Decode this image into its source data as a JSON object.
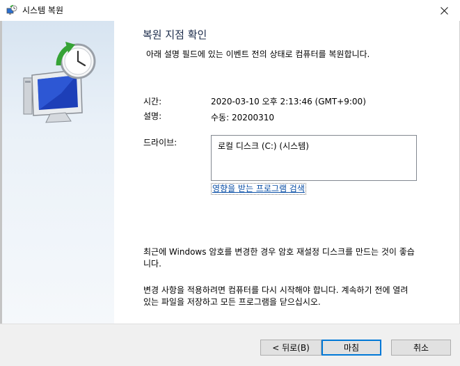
{
  "window": {
    "title": "시스템 복원"
  },
  "main": {
    "heading": "복원 지점 확인",
    "subheading": "아래 설명 필드에 있는 이벤트 전의 상태로 컴퓨터를 복원합니다.",
    "time_label": "시간:",
    "time_value": "2020-03-10 오후 2:13:46 (GMT+9:00)",
    "description_label": "설명:",
    "description_value": "수동: 20200310",
    "drives_label": "드라이브:",
    "drives": [
      "로컬 디스크 (C:) (시스템)"
    ],
    "scan_link": "영향을 받는 프로그램 검색",
    "note_password_line1": "최근에 Windows 암호를 변경한 경우 암호 재설정 디스크를 만드는 것이 좋습",
    "note_password_line2": "니다.",
    "note_restart_line1": "변경 사항을 적용하려면 컴퓨터를 다시 시작해야 합니다. 계속하기 전에 열려",
    "note_restart_line2": "있는 파일을 저장하고 모든 프로그램을 닫으십시오."
  },
  "buttons": {
    "back": "< 뒤로(B)",
    "finish": "마침",
    "cancel": "취소"
  },
  "colors": {
    "accent": "#0078d7",
    "link": "#0a4fa6",
    "footer_bg": "#f0f0f0"
  }
}
